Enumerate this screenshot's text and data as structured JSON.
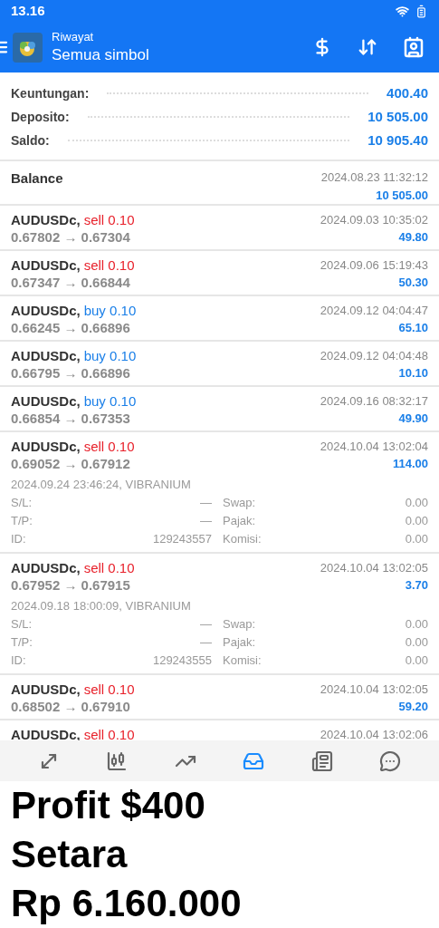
{
  "status_bar": {
    "time": "13.16"
  },
  "header": {
    "subtitle": "Riwayat",
    "title": "Semua simbol"
  },
  "summary": [
    {
      "label": "Keuntungan:",
      "value": "400.40"
    },
    {
      "label": "Deposito:",
      "value": "10 505.00"
    },
    {
      "label": "Saldo:",
      "value": "10 905.40"
    }
  ],
  "deals": [
    {
      "kind": "balance",
      "title": "Balance",
      "time": "2024.08.23 11:32:12",
      "profit": "10 505.00"
    },
    {
      "kind": "trade",
      "symbol": "AUDUSDc,",
      "order": "sell 0.10",
      "is_sell": true,
      "prices": "0.67802 → 0.67304",
      "time": "2024.09.03 10:35:02",
      "profit": "49.80",
      "expanded": false
    },
    {
      "kind": "trade",
      "symbol": "AUDUSDc,",
      "order": "sell 0.10",
      "is_sell": true,
      "prices": "0.67347 → 0.66844",
      "time": "2024.09.06 15:19:43",
      "profit": "50.30",
      "expanded": false
    },
    {
      "kind": "trade",
      "symbol": "AUDUSDc,",
      "order": "buy 0.10",
      "is_sell": false,
      "prices": "0.66245 → 0.66896",
      "time": "2024.09.12 04:04:47",
      "profit": "65.10",
      "expanded": false
    },
    {
      "kind": "trade",
      "symbol": "AUDUSDc,",
      "order": "buy 0.10",
      "is_sell": false,
      "prices": "0.66795 → 0.66896",
      "time": "2024.09.12 04:04:48",
      "profit": "10.10",
      "expanded": false
    },
    {
      "kind": "trade",
      "symbol": "AUDUSDc,",
      "order": "buy 0.10",
      "is_sell": false,
      "prices": "0.66854 → 0.67353",
      "time": "2024.09.16 08:32:17",
      "profit": "49.90",
      "expanded": false
    },
    {
      "kind": "trade",
      "symbol": "AUDUSDc,",
      "order": "sell 0.10",
      "is_sell": true,
      "prices": "0.69052 → 0.67912",
      "time": "2024.10.04 13:02:04",
      "profit": "114.00",
      "expanded": true,
      "opened": "2024.09.24 23:46:24, VIBRANIUM",
      "details": [
        {
          "label": "S/L:",
          "value": "—",
          "label2": "Swap:",
          "value2": "0.00"
        },
        {
          "label": "T/P:",
          "value": "—",
          "label2": "Pajak:",
          "value2": "0.00"
        },
        {
          "label": "ID:",
          "value": "129243557",
          "label2": "Komisi:",
          "value2": "0.00"
        }
      ]
    },
    {
      "kind": "trade",
      "symbol": "AUDUSDc,",
      "order": "sell 0.10",
      "is_sell": true,
      "prices": "0.67952 → 0.67915",
      "time": "2024.10.04 13:02:05",
      "profit": "3.70",
      "expanded": true,
      "opened": "2024.09.18 18:00:09, VIBRANIUM",
      "details": [
        {
          "label": "S/L:",
          "value": "—",
          "label2": "Swap:",
          "value2": "0.00"
        },
        {
          "label": "T/P:",
          "value": "—",
          "label2": "Pajak:",
          "value2": "0.00"
        },
        {
          "label": "ID:",
          "value": "129243555",
          "label2": "Komisi:",
          "value2": "0.00"
        }
      ]
    },
    {
      "kind": "trade",
      "symbol": "AUDUSDc,",
      "order": "sell 0.10",
      "is_sell": true,
      "prices": "0.68502 → 0.67910",
      "time": "2024.10.04 13:02:05",
      "profit": "59.20",
      "expanded": false
    },
    {
      "kind": "trade",
      "symbol": "AUDUSDc,",
      "order": "sell 0.10",
      "is_sell": true,
      "time": "2024.10.04 13:02:06"
    }
  ],
  "nav": [
    {
      "selected": false
    },
    {
      "selected": false
    },
    {
      "selected": false
    },
    {
      "selected": true
    },
    {
      "selected": false
    },
    {
      "selected": false
    }
  ],
  "caption": [
    "Profit $400",
    "Setara",
    "Rp 6.160.000"
  ]
}
